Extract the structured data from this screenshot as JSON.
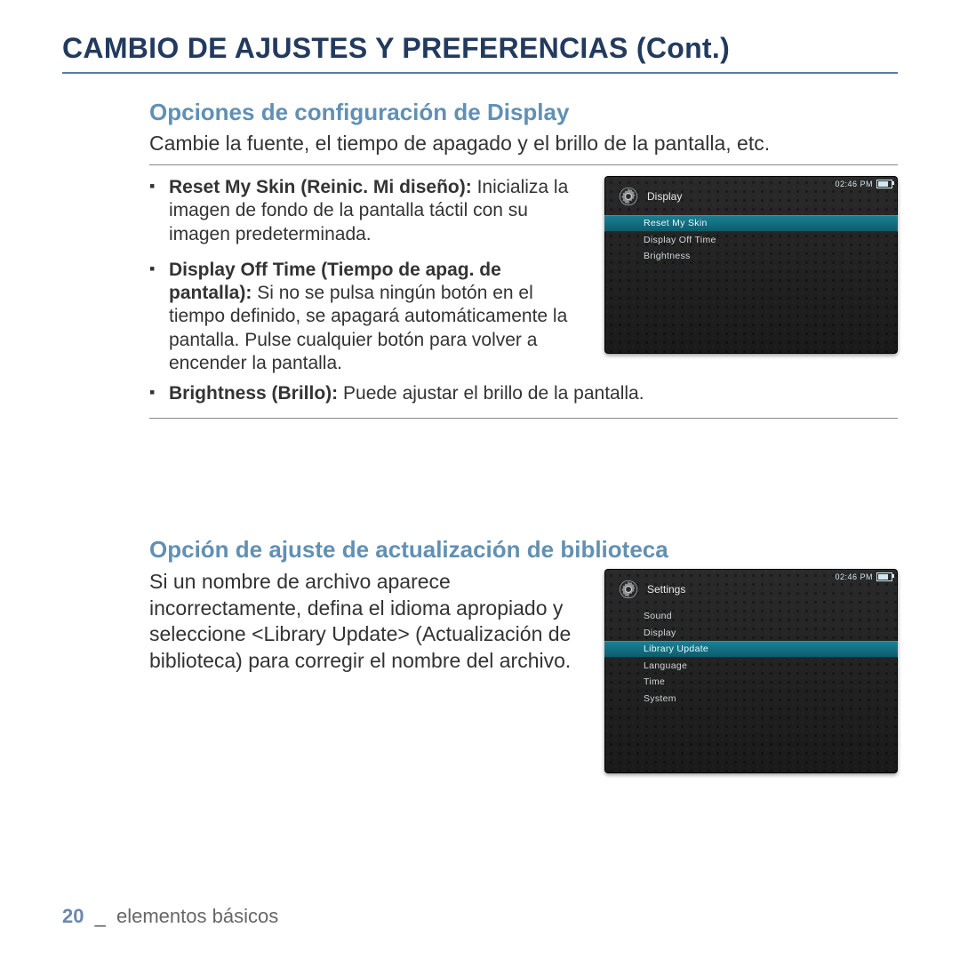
{
  "title": "CAMBIO DE AJUSTES Y PREFERENCIAS (Cont.)",
  "section1": {
    "heading": "Opciones de configuración de Display",
    "intro": "Cambie la fuente, el tiempo de apagado y el brillo de la pantalla, etc.",
    "bullets": {
      "b1": {
        "label": "Reset My Skin (Reinic. Mi diseño): ",
        "text": "Inicializa la imagen de fondo de la pantalla táctil con su imagen predeterminada."
      },
      "b2": {
        "label": "Display Off Time (Tiempo de apag. de pantalla): ",
        "text": "Si no se pulsa ningún botón en el tiempo definido, se apagará automáticamente la pantalla. Pulse cualquier botón para volver a encender la pantalla."
      },
      "b3": {
        "label": "Brightness (Brillo): ",
        "text": "Puede ajustar el brillo de la pantalla."
      }
    },
    "device": {
      "time": "02:46 PM",
      "title": "Display",
      "items": [
        "Reset My Skin",
        "Display Off Time",
        "Brightness"
      ],
      "selectedIndex": 0
    }
  },
  "section2": {
    "heading": "Opción de ajuste de actualización de biblioteca",
    "para": "Si un nombre de archivo aparece incorrectamente, defina el idioma apropiado y seleccione <Library Update> (Actualización de biblioteca) para corregir el nombre del archivo.",
    "device": {
      "time": "02:46 PM",
      "title": "Settings",
      "items": [
        "Sound",
        "Display",
        "Library Update",
        "Language",
        "Time",
        "System"
      ],
      "selectedIndex": 2
    }
  },
  "footer": {
    "page": "20",
    "sep": "_",
    "text": "elementos básicos"
  }
}
